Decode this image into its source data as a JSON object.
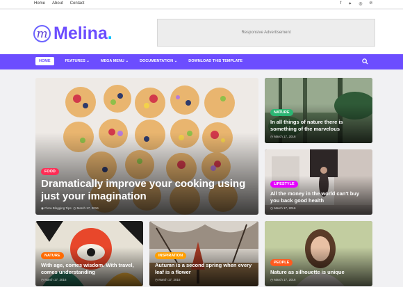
{
  "topbar": {
    "links": [
      "Home",
      "About",
      "Contact"
    ],
    "social": [
      "facebook-icon",
      "twitter-icon",
      "instagram-icon",
      "pinterest-icon"
    ]
  },
  "header": {
    "logo_mark": "m",
    "logo_text": "Melina",
    "logo_dot": ".",
    "ad_text": "Responsive Advertisement"
  },
  "nav": {
    "items": [
      "HOME",
      "FEATURES",
      "MEGA MENU",
      "DOCUMENTATION",
      "DOWNLOAD THIS TEMPLATE"
    ],
    "dropdown_marks": [
      "",
      "⌄",
      "⌄",
      "⌄",
      ""
    ]
  },
  "posts": [
    {
      "tag": "FOOD",
      "tag_color": "#ff2d55",
      "title": "Dramatically improve your cooking using just your imagination",
      "author": "Flora Blogging Tips",
      "date": "March 17, 2016"
    },
    {
      "tag": "NATURE",
      "tag_color": "#2bb673",
      "title": "In all things of nature there is something of the marvelous",
      "date": "March 17, 2016"
    },
    {
      "tag": "LIFESTYLE",
      "tag_color": "#e500ff",
      "title": "All the money in the world can't buy you back good health",
      "date": "March 17, 2016"
    },
    {
      "tag": "NATURE",
      "tag_color": "#ff6a00",
      "title": "With age, comes wisdom. With travel, comes understanding",
      "date": "March 17, 2016"
    },
    {
      "tag": "INSPIRATION",
      "tag_color": "#ff9f00",
      "title": "Autumn is a second spring when every leaf is a flower",
      "date": "March 17, 2016"
    },
    {
      "tag": "PEOPLE",
      "tag_color": "#ff5a1f",
      "title": "Nature as silhouette is unique",
      "date": "March 17, 2016"
    }
  ]
}
